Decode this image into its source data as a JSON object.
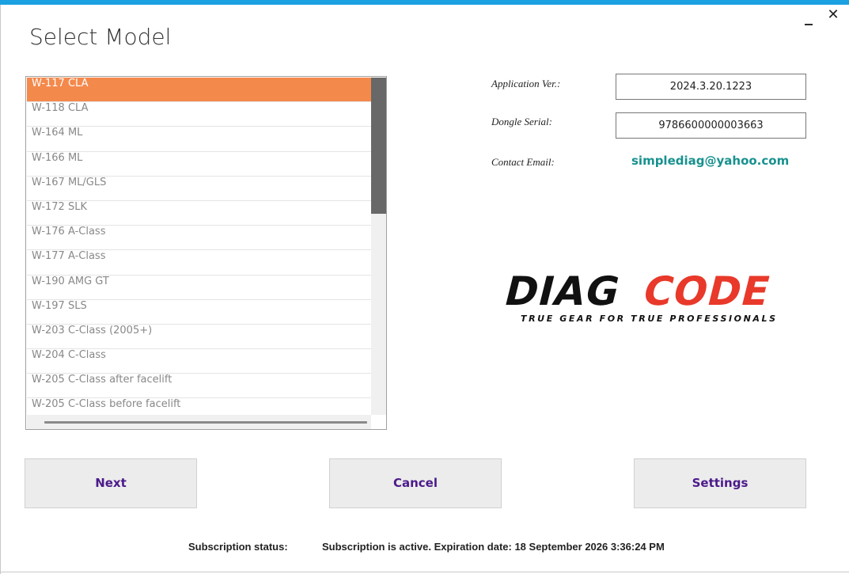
{
  "window": {
    "accent_color": "#1ba1e2",
    "minimize_label": "_",
    "close_label": "✕",
    "title": "Select Model"
  },
  "model_list": {
    "items": [
      "W-117 CLA",
      "W-118 CLA",
      "W-164 ML",
      "W-166 ML",
      "W-167 ML/GLS",
      "W-172 SLK",
      "W-176 A-Class",
      "W-177 A-Class",
      "W-190 AMG GT",
      "W-197 SLS",
      "W-203 C-Class (2005+)",
      "W-204 C-Class",
      "W-205 C-Class after facelift",
      "W-205 C-Class before facelift"
    ],
    "selected_index": 0,
    "selected_color": "#f4894c"
  },
  "info": {
    "app_ver_label": "Application Ver.:",
    "app_ver_value": "2024.3.20.1223",
    "dongle_label": "Dongle Serial:",
    "dongle_value": "9786600000003663",
    "contact_label": "Contact Email:",
    "contact_email": "simplediag@yahoo.com",
    "email_color": "#17918f"
  },
  "logo": {
    "brand_left": "DIAG",
    "brand_right": "CODE",
    "tagline": "TRUE GEAR FOR TRUE PROFESSIONALS",
    "brand_left_color": "#111111",
    "brand_right_color": "#e8392a"
  },
  "buttons": {
    "next": "Next",
    "cancel": "Cancel",
    "settings": "Settings",
    "text_color": "#4b1a8a"
  },
  "status": {
    "label": "Subscription status:",
    "text": "Subscription is active.  Expiration date: 18 September 2026 3:36:24 PM"
  }
}
